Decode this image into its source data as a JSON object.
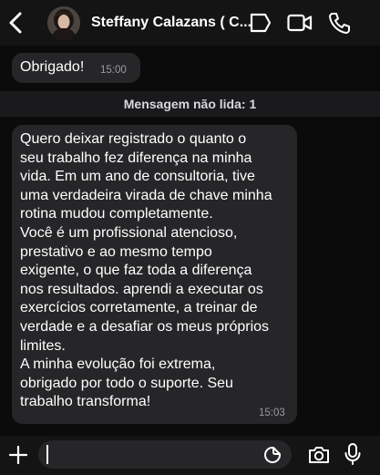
{
  "header": {
    "contact_name": "Steffany Calazans ( C...",
    "icons": [
      "back-chevron-icon",
      "avatar",
      "sticker-icon",
      "video-call-icon",
      "phone-icon"
    ]
  },
  "messages": [
    {
      "direction": "outgoing",
      "text": "Obrigado!",
      "time": "15:00"
    }
  ],
  "unread_divider": {
    "label": "Mensagem não lida: 1"
  },
  "incoming_message": {
    "text": "Quero deixar registrado o quanto o\nseu trabalho fez diferença na minha\nvida. Em um ano de consultoria, tive\numa verdadeira virada de chave minha\nrotina mudou completamente.\nVocê é um profissional atencioso,\nprestativo e ao mesmo tempo\nexigente, o que faz toda a diferença\nnos resultados. aprendi a executar os\nexercícios corretamente, a treinar de\nverdade e a desafiar os meus próprios\nlimites.\nA minha evolução foi extrema,\nobrigado por todo o suporte. Seu\ntrabalho transforma!",
    "time": "15:03"
  },
  "composer": {
    "input_value": "",
    "icons": [
      "plus-icon",
      "sticker-icon",
      "camera-icon",
      "microphone-icon"
    ]
  },
  "colors": {
    "background": "#0b0b0c",
    "header_bg": "#141414",
    "bubble_bg": "#262628",
    "timestamp": "#9c9c9f"
  }
}
